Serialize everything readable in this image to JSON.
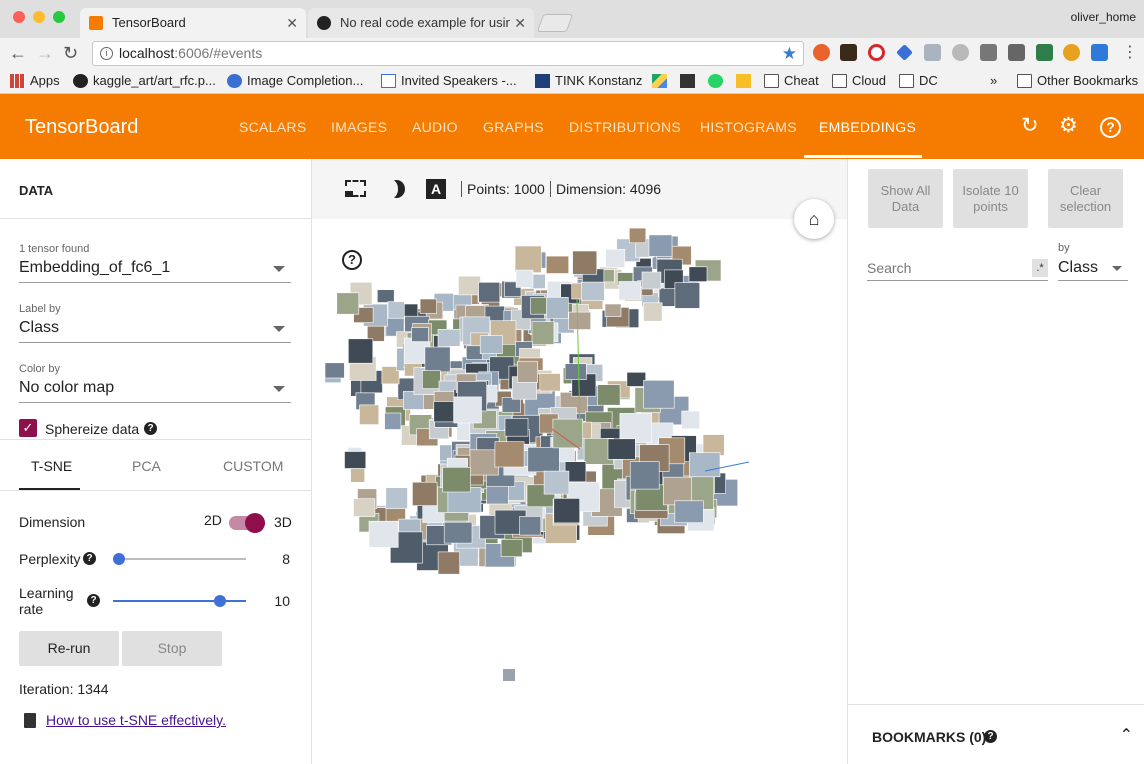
{
  "browser": {
    "profile": "oliver_home",
    "tabs": [
      {
        "title": "TensorBoard",
        "active": true
      },
      {
        "title": "No real code example for using",
        "active": false
      }
    ],
    "url_host": "localhost",
    "url_path": ":6006/#events",
    "bookmarks": [
      "Apps",
      "kaggle_art/art_rfc.p...",
      "Image Completion...",
      "Invited Speakers -...",
      "TINK Konstanz",
      "Cheat",
      "Cloud",
      "DC"
    ],
    "other_bookmarks": "Other Bookmarks",
    "overflow": "»"
  },
  "header": {
    "brand": "TensorBoard",
    "nav": [
      "SCALARS",
      "IMAGES",
      "AUDIO",
      "GRAPHS",
      "DISTRIBUTIONS",
      "HISTOGRAMS",
      "EMBEDDINGS"
    ],
    "active_nav": "EMBEDDINGS",
    "accent": "#f57c00"
  },
  "left": {
    "title": "DATA",
    "tensor_found": "1 tensor found",
    "tensor": "Embedding_of_fc6_1",
    "label_by_label": "Label by",
    "label_by": "Class",
    "color_by_label": "Color by",
    "color_by": "No color map",
    "sphereize": "Sphereize data",
    "tabs": [
      "T-SNE",
      "PCA",
      "CUSTOM"
    ],
    "dimension_label": "Dimension",
    "dim_2d": "2D",
    "dim_3d": "3D",
    "perplexity_label": "Perplexity",
    "perplexity": "8",
    "learning_rate_label_1": "Learning",
    "learning_rate_label_2": "rate",
    "learning_rate": "10",
    "rerun": "Re-run",
    "stop": "Stop",
    "iteration": "Iteration: 1344",
    "help_link": "How to use t-SNE effectively."
  },
  "center": {
    "points": "Points: 1000",
    "dimension": "Dimension: 4096",
    "help": "?"
  },
  "right": {
    "show_all": "Show All Data",
    "isolate": "Isolate 10 points",
    "clear": "Clear selection",
    "search_placeholder": "Search",
    "regex": ".*",
    "by_label": "by",
    "by_value": "Class",
    "bookmarks": "BOOKMARKS (0)"
  }
}
